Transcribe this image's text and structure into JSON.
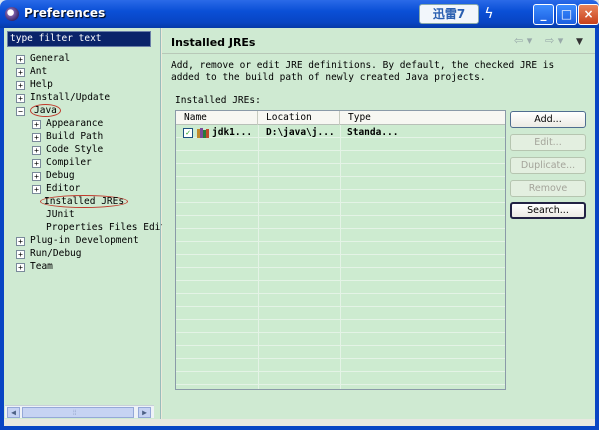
{
  "window": {
    "title": "Preferences"
  },
  "xunlei": {
    "label": "迅雷7",
    "bolt": "ϟ"
  },
  "window_controls": {
    "minimize": "_",
    "maximize": "□",
    "close": "×"
  },
  "filter": {
    "value": "type filter text"
  },
  "tree": [
    {
      "label": "General",
      "expander": "+"
    },
    {
      "label": "Ant",
      "expander": "+"
    },
    {
      "label": "Help",
      "expander": "+"
    },
    {
      "label": "Install/Update",
      "expander": "+"
    },
    {
      "label": "Java",
      "expander": "−"
    },
    {
      "label": "Appearance",
      "expander": "+"
    },
    {
      "label": "Build Path",
      "expander": "+"
    },
    {
      "label": "Code Style",
      "expander": "+"
    },
    {
      "label": "Compiler",
      "expander": "+"
    },
    {
      "label": "Debug",
      "expander": "+"
    },
    {
      "label": "Editor",
      "expander": "+"
    },
    {
      "label": "Installed JREs",
      "expander": ""
    },
    {
      "label": "JUnit",
      "expander": ""
    },
    {
      "label": "Properties Files Edit",
      "expander": ""
    },
    {
      "label": "Plug-in Development",
      "expander": "+"
    },
    {
      "label": "Run/Debug",
      "expander": "+"
    },
    {
      "label": "Team",
      "expander": "+"
    }
  ],
  "scroll": {
    "left": "◀",
    "right": "▶",
    "grip": "⦙⦙"
  },
  "page": {
    "title": "Installed JREs",
    "nav_back": "⇦ ▾",
    "nav_forward": "⇨ ▾",
    "menu": "▼",
    "description": "Add, remove or edit JRE definitions. By default, the checked JRE is added to the build path of newly created Java projects.",
    "table_label": "Installed JREs:"
  },
  "table": {
    "columns": [
      "Name",
      "Location",
      "Type"
    ],
    "rows": [
      {
        "checked": "✓",
        "name": "jdk1...",
        "location": "D:\\java\\j...",
        "type": "Standa..."
      }
    ]
  },
  "buttons": {
    "add": "Add...",
    "edit": "Edit...",
    "duplicate": "Duplicate...",
    "remove": "Remove",
    "search": "Search..."
  },
  "colors": {
    "titlebar": "#0a4fd6",
    "pane_bg": "#cfead2",
    "selection_outline": "#c0392b"
  }
}
